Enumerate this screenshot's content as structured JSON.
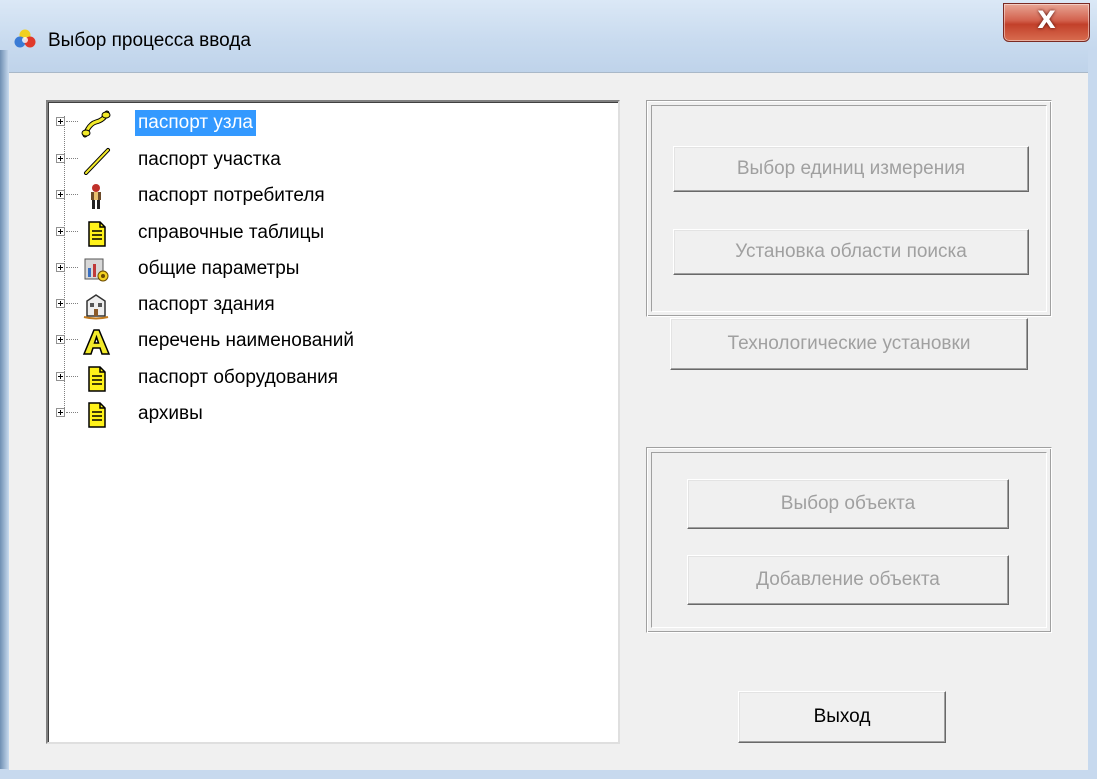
{
  "window": {
    "title": "Выбор процесса ввода",
    "close_label": "X",
    "app_icon": "color-balls-icon"
  },
  "tree": {
    "items": [
      {
        "label": "паспорт узла",
        "icon": "node-pipe-icon",
        "selected": true
      },
      {
        "label": "паспорт участка",
        "icon": "pencil-line-icon",
        "selected": false
      },
      {
        "label": "паспорт потребителя",
        "icon": "consumer-figure-icon",
        "selected": false
      },
      {
        "label": "справочные таблицы",
        "icon": "document-icon",
        "selected": false
      },
      {
        "label": "общие параметры",
        "icon": "settings-chart-icon",
        "selected": false
      },
      {
        "label": "паспорт здания",
        "icon": "building-icon",
        "selected": false
      },
      {
        "label": "перечень наименований",
        "icon": "letter-a-icon",
        "selected": false
      },
      {
        "label": "паспорт оборудования",
        "icon": "document-icon",
        "selected": false
      },
      {
        "label": "архивы",
        "icon": "document-icon",
        "selected": false
      }
    ]
  },
  "settings_group": {
    "units_button": "Выбор единиц измерения",
    "search_area_button": "Установка области поиска",
    "tech_settings_button": "Технологические установки"
  },
  "object_group": {
    "select_object_button": "Выбор объекта",
    "add_object_button": "Добавление объекта"
  },
  "exit_button": "Выход"
}
